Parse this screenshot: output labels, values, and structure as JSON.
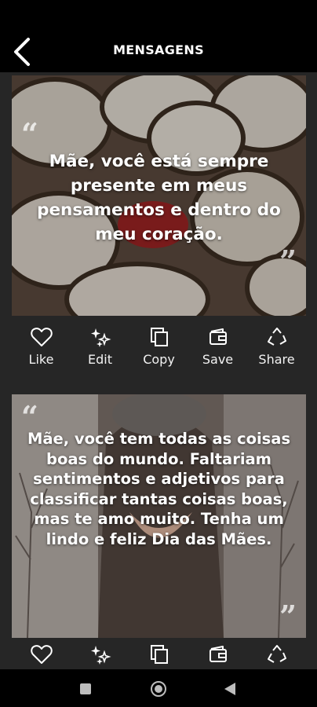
{
  "header": {
    "title": "MENSAGENS"
  },
  "icons": {
    "back": "chevron-left-icon",
    "like": "heart-outline-icon",
    "edit": "sparkles-icon",
    "copy": "copy-icon",
    "save": "wallet-save-icon",
    "share": "recycle-share-icon"
  },
  "actions": {
    "like_label": "Like",
    "edit_label": "Edit",
    "copy_label": "Copy",
    "save_label": "Save",
    "share_label": "Share"
  },
  "quotes": [
    {
      "text": "Mãe, você está sempre presente em meus pensamentos e dentro do meu coração."
    },
    {
      "text": "Mãe, você tem todas as coisas boas do mundo. Faltariam sentimentos e adjetivos para classificar tantas coisas boas, mas te amo muito. Tenha um lindo e feliz Dia das Mães."
    }
  ],
  "colors": {
    "topbar": "#000000",
    "background": "#262626",
    "text": "#ffffff"
  }
}
